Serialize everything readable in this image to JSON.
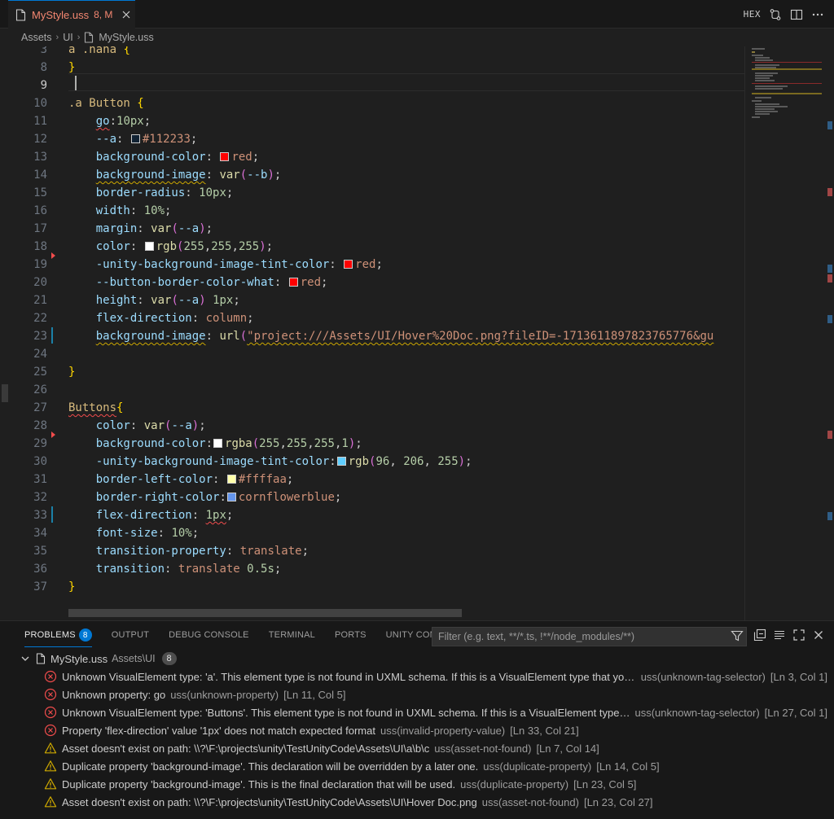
{
  "tab": {
    "title": "MyStyle.uss",
    "badge": "8, M"
  },
  "actions": {
    "hex_label": "HEX"
  },
  "breadcrumb": {
    "items": [
      "Assets",
      "UI",
      "MyStyle.uss"
    ]
  },
  "editor": {
    "current_line": "9",
    "lines": [
      {
        "n": "3",
        "segs": [
          {
            "t": "a .haha ",
            "c": "t-sel"
          },
          {
            "t": "{",
            "c": "t-brace"
          }
        ]
      },
      {
        "n": "8",
        "segs": [
          {
            "t": "}",
            "c": "t-brace"
          }
        ]
      },
      {
        "n": "9",
        "segs": []
      },
      {
        "n": "10",
        "segs": [
          {
            "t": ".a Button ",
            "c": "t-sel"
          },
          {
            "t": "{",
            "c": "t-brace"
          }
        ]
      },
      {
        "n": "11",
        "segs": [
          {
            "t": "    "
          },
          {
            "t": "go",
            "c": "t-prop sq-red"
          },
          {
            "t": ":"
          },
          {
            "t": "10px",
            "c": "t-num"
          },
          {
            "t": ";"
          }
        ]
      },
      {
        "n": "12",
        "segs": [
          {
            "t": "    "
          },
          {
            "t": "--a",
            "c": "t-prop"
          },
          {
            "t": ": "
          },
          {
            "sw": "#112233"
          },
          {
            "t": "#112233",
            "c": "t-str"
          },
          {
            "t": ";"
          }
        ]
      },
      {
        "n": "13",
        "segs": [
          {
            "t": "    "
          },
          {
            "t": "background-color",
            "c": "t-prop"
          },
          {
            "t": ": "
          },
          {
            "sw": "#ff0000"
          },
          {
            "t": "red",
            "c": "t-kw"
          },
          {
            "t": ";"
          }
        ]
      },
      {
        "n": "14",
        "segs": [
          {
            "t": "    "
          },
          {
            "t": "background-image",
            "c": "t-prop sq-yel"
          },
          {
            "t": ": "
          },
          {
            "t": "var",
            "c": "t-fn"
          },
          {
            "t": "(",
            "c": "t-paren"
          },
          {
            "t": "--b",
            "c": "t-prop"
          },
          {
            "t": ")",
            "c": "t-paren"
          },
          {
            "t": ";"
          }
        ]
      },
      {
        "n": "15",
        "segs": [
          {
            "t": "    "
          },
          {
            "t": "border-radius",
            "c": "t-prop"
          },
          {
            "t": ": "
          },
          {
            "t": "10px",
            "c": "t-num"
          },
          {
            "t": ";"
          }
        ]
      },
      {
        "n": "16",
        "segs": [
          {
            "t": "    "
          },
          {
            "t": "width",
            "c": "t-prop"
          },
          {
            "t": ": "
          },
          {
            "t": "10%",
            "c": "t-num"
          },
          {
            "t": ";"
          }
        ]
      },
      {
        "n": "17",
        "segs": [
          {
            "t": "    "
          },
          {
            "t": "margin",
            "c": "t-prop"
          },
          {
            "t": ": "
          },
          {
            "t": "var",
            "c": "t-fn"
          },
          {
            "t": "(",
            "c": "t-paren"
          },
          {
            "t": "--a",
            "c": "t-prop"
          },
          {
            "t": ")",
            "c": "t-paren"
          },
          {
            "t": ";"
          }
        ]
      },
      {
        "n": "18",
        "segs": [
          {
            "t": "    "
          },
          {
            "t": "color",
            "c": "t-prop"
          },
          {
            "t": ": "
          },
          {
            "sw": "#ffffff"
          },
          {
            "t": "rgb",
            "c": "t-fn"
          },
          {
            "t": "(",
            "c": "t-paren"
          },
          {
            "t": "255",
            "c": "t-num"
          },
          {
            "t": ","
          },
          {
            "t": "255",
            "c": "t-num"
          },
          {
            "t": ","
          },
          {
            "t": "255",
            "c": "t-num"
          },
          {
            "t": ")",
            "c": "t-paren"
          },
          {
            "t": ";"
          }
        ]
      },
      {
        "n": "19",
        "segs": [
          {
            "t": "    "
          },
          {
            "t": "-unity-background-image-tint-color",
            "c": "t-prop"
          },
          {
            "t": ": "
          },
          {
            "sw": "#ff0000"
          },
          {
            "t": "red",
            "c": "t-kw"
          },
          {
            "t": ";"
          }
        ]
      },
      {
        "n": "20",
        "segs": [
          {
            "t": "    "
          },
          {
            "t": "--button-border-color-what",
            "c": "t-prop"
          },
          {
            "t": ": "
          },
          {
            "sw": "#ff0000"
          },
          {
            "t": "red",
            "c": "t-kw"
          },
          {
            "t": ";"
          }
        ]
      },
      {
        "n": "21",
        "segs": [
          {
            "t": "    "
          },
          {
            "t": "height",
            "c": "t-prop"
          },
          {
            "t": ": "
          },
          {
            "t": "var",
            "c": "t-fn"
          },
          {
            "t": "(",
            "c": "t-paren"
          },
          {
            "t": "--a",
            "c": "t-prop"
          },
          {
            "t": ")",
            "c": "t-paren"
          },
          {
            "t": " "
          },
          {
            "t": "1px",
            "c": "t-num"
          },
          {
            "t": ";"
          }
        ]
      },
      {
        "n": "22",
        "segs": [
          {
            "t": "    "
          },
          {
            "t": "flex-direction",
            "c": "t-prop"
          },
          {
            "t": ": "
          },
          {
            "t": "column",
            "c": "t-kw"
          },
          {
            "t": ";"
          }
        ]
      },
      {
        "n": "23",
        "segs": [
          {
            "t": "    "
          },
          {
            "t": "background-image",
            "c": "t-prop sq-yel"
          },
          {
            "t": ": "
          },
          {
            "t": "url",
            "c": "t-fn"
          },
          {
            "t": "(",
            "c": "t-paren"
          },
          {
            "t": "\"project:///Assets/UI/Hover%20Doc.png?fileID=-1713611897823765776&gu",
            "c": "t-str sq-yel"
          }
        ]
      },
      {
        "n": "24",
        "segs": []
      },
      {
        "n": "25",
        "segs": [
          {
            "t": "}",
            "c": "t-brace"
          }
        ]
      },
      {
        "n": "26",
        "segs": []
      },
      {
        "n": "27",
        "segs": [
          {
            "t": "Buttons",
            "c": "t-sel sq-red"
          },
          {
            "t": "{",
            "c": "t-brace"
          }
        ]
      },
      {
        "n": "28",
        "segs": [
          {
            "t": "    "
          },
          {
            "t": "color",
            "c": "t-prop"
          },
          {
            "t": ": "
          },
          {
            "t": "var",
            "c": "t-fn"
          },
          {
            "t": "(",
            "c": "t-paren"
          },
          {
            "t": "--a",
            "c": "t-prop"
          },
          {
            "t": ")",
            "c": "t-paren"
          },
          {
            "t": ";"
          }
        ]
      },
      {
        "n": "29",
        "segs": [
          {
            "t": "    "
          },
          {
            "t": "background-color",
            "c": "t-prop"
          },
          {
            "t": ":"
          },
          {
            "sw": "#ffffff"
          },
          {
            "t": "rgba",
            "c": "t-fn"
          },
          {
            "t": "(",
            "c": "t-paren"
          },
          {
            "t": "255",
            "c": "t-num"
          },
          {
            "t": ","
          },
          {
            "t": "255",
            "c": "t-num"
          },
          {
            "t": ","
          },
          {
            "t": "255",
            "c": "t-num"
          },
          {
            "t": ","
          },
          {
            "t": "1",
            "c": "t-num"
          },
          {
            "t": ")",
            "c": "t-paren"
          },
          {
            "t": ";"
          }
        ]
      },
      {
        "n": "30",
        "segs": [
          {
            "t": "    "
          },
          {
            "t": "-unity-background-image-tint-color",
            "c": "t-prop"
          },
          {
            "t": ":"
          },
          {
            "sw": "#60ceff"
          },
          {
            "t": "rgb",
            "c": "t-fn"
          },
          {
            "t": "(",
            "c": "t-paren"
          },
          {
            "t": "96",
            "c": "t-num"
          },
          {
            "t": ", "
          },
          {
            "t": "206",
            "c": "t-num"
          },
          {
            "t": ", "
          },
          {
            "t": "255",
            "c": "t-num"
          },
          {
            "t": ")",
            "c": "t-paren"
          },
          {
            "t": ";"
          }
        ]
      },
      {
        "n": "31",
        "segs": [
          {
            "t": "    "
          },
          {
            "t": "border-left-color",
            "c": "t-prop"
          },
          {
            "t": ": "
          },
          {
            "sw": "#ffffaa"
          },
          {
            "t": "#ffffaa",
            "c": "t-str"
          },
          {
            "t": ";"
          }
        ]
      },
      {
        "n": "32",
        "segs": [
          {
            "t": "    "
          },
          {
            "t": "border-right-color",
            "c": "t-prop"
          },
          {
            "t": ":"
          },
          {
            "sw": "#6495ed"
          },
          {
            "t": "cornflowerblue",
            "c": "t-kw"
          },
          {
            "t": ";"
          }
        ]
      },
      {
        "n": "33",
        "segs": [
          {
            "t": "    "
          },
          {
            "t": "flex-direction",
            "c": "t-prop"
          },
          {
            "t": ": "
          },
          {
            "t": "1px",
            "c": "t-num sq-red"
          },
          {
            "t": ";"
          }
        ]
      },
      {
        "n": "34",
        "segs": [
          {
            "t": "    "
          },
          {
            "t": "font-size",
            "c": "t-prop"
          },
          {
            "t": ": "
          },
          {
            "t": "10%",
            "c": "t-num"
          },
          {
            "t": ";"
          }
        ]
      },
      {
        "n": "35",
        "segs": [
          {
            "t": "    "
          },
          {
            "t": "transition-property",
            "c": "t-prop"
          },
          {
            "t": ": "
          },
          {
            "t": "translate",
            "c": "t-kw"
          },
          {
            "t": ";"
          }
        ]
      },
      {
        "n": "36",
        "segs": [
          {
            "t": "    "
          },
          {
            "t": "transition",
            "c": "t-prop"
          },
          {
            "t": ": "
          },
          {
            "t": "translate",
            "c": "t-kw"
          },
          {
            "t": " "
          },
          {
            "t": "0.5s",
            "c": "t-num"
          },
          {
            "t": ";"
          }
        ]
      },
      {
        "n": "37",
        "segs": [
          {
            "t": "}",
            "c": "t-brace"
          }
        ]
      }
    ]
  },
  "panel": {
    "tabs": [
      {
        "label": "PROBLEMS",
        "badge": "8",
        "active": true
      },
      {
        "label": "OUTPUT"
      },
      {
        "label": "DEBUG CONSOLE"
      },
      {
        "label": "TERMINAL"
      },
      {
        "label": "PORTS"
      },
      {
        "label": "UNITY CONSOLE"
      }
    ],
    "filter_placeholder": "Filter (e.g. text, **/*.ts, !**/node_modules/**)",
    "file": {
      "name": "MyStyle.uss",
      "path": "Assets\\UI",
      "count": "8"
    },
    "problems": [
      {
        "severity": "error",
        "message": "Unknown VisualElement type: 'a'. This element type is not found in UXML schema. If this is a VisualElement type that you j...",
        "code": "uss(unknown-tag-selector)",
        "loc": "[Ln 3, Col 1]"
      },
      {
        "severity": "error",
        "message": "Unknown property: go",
        "code": "uss(unknown-property)",
        "loc": "[Ln 11, Col 5]"
      },
      {
        "severity": "error",
        "message": "Unknown VisualElement type: 'Buttons'. This element type is not found in UXML schema. If this is a VisualElement type t...",
        "code": "uss(unknown-tag-selector)",
        "loc": "[Ln 27, Col 1]"
      },
      {
        "severity": "error",
        "message": "Property 'flex-direction' value '1px' does not match expected format",
        "code": "uss(invalid-property-value)",
        "loc": "[Ln 33, Col 21]"
      },
      {
        "severity": "warning",
        "message": "Asset doesn't exist on path: \\\\?\\F:\\projects\\unity\\TestUnityCode\\Assets\\UI\\a\\b\\c",
        "code": "uss(asset-not-found)",
        "loc": "[Ln 7, Col 14]"
      },
      {
        "severity": "warning",
        "message": "Duplicate property 'background-image'. This declaration will be overridden by a later one.",
        "code": "uss(duplicate-property)",
        "loc": "[Ln 14, Col 5]"
      },
      {
        "severity": "warning",
        "message": "Duplicate property 'background-image'. This is the final declaration that will be used.",
        "code": "uss(duplicate-property)",
        "loc": "[Ln 23, Col 5]"
      },
      {
        "severity": "warning",
        "message": "Asset doesn't exist on path: \\\\?\\F:\\projects\\unity\\TestUnityCode\\Assets\\UI\\Hover Doc.png",
        "code": "uss(asset-not-found)",
        "loc": "[Ln 23, Col 27]"
      }
    ]
  },
  "colors": {
    "error": "#f14c4c",
    "warning": "#cca700",
    "accent": "#0078d4",
    "modified_tab": "#f48771"
  }
}
